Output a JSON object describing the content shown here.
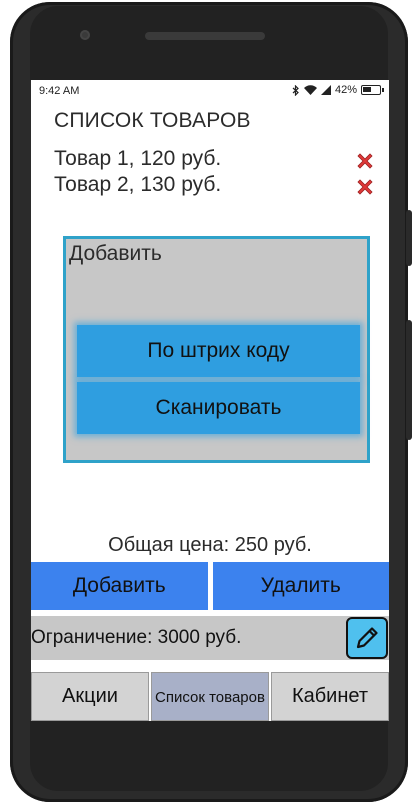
{
  "status": {
    "time": "9:42 AM",
    "battery": "42%"
  },
  "header": {
    "title": "СПИСОК ТОВАРОВ"
  },
  "items": [
    {
      "label": "Товар 1, 120 руб."
    },
    {
      "label": "Товар 2, 130 руб."
    }
  ],
  "add_panel": {
    "title": "Добавить",
    "barcode_label": "По штрих коду",
    "scan_label": "Сканировать"
  },
  "total": {
    "label": "Общая цена: 250 руб."
  },
  "actions": {
    "add_label": "Добавить",
    "remove_label": "Удалить"
  },
  "limit": {
    "label": "Ограничение: 3000 руб."
  },
  "nav": {
    "tabs": [
      {
        "label": "Акции",
        "active": false
      },
      {
        "label": "Список товаров",
        "active": true
      },
      {
        "label": "Кабинет",
        "active": false
      }
    ]
  },
  "colors": {
    "accent_blue": "#3c82ee",
    "panel_blue": "#2f9ee0",
    "panel_border": "#2fa2c9",
    "delete_red": "#e03a3a",
    "edit_icon_bg": "#4fc0ee",
    "active_tab": "#a8b0c8"
  },
  "icons": [
    "bluetooth-icon",
    "wifi-icon",
    "signal-icon",
    "battery-icon",
    "delete-icon",
    "pencil-icon"
  ]
}
